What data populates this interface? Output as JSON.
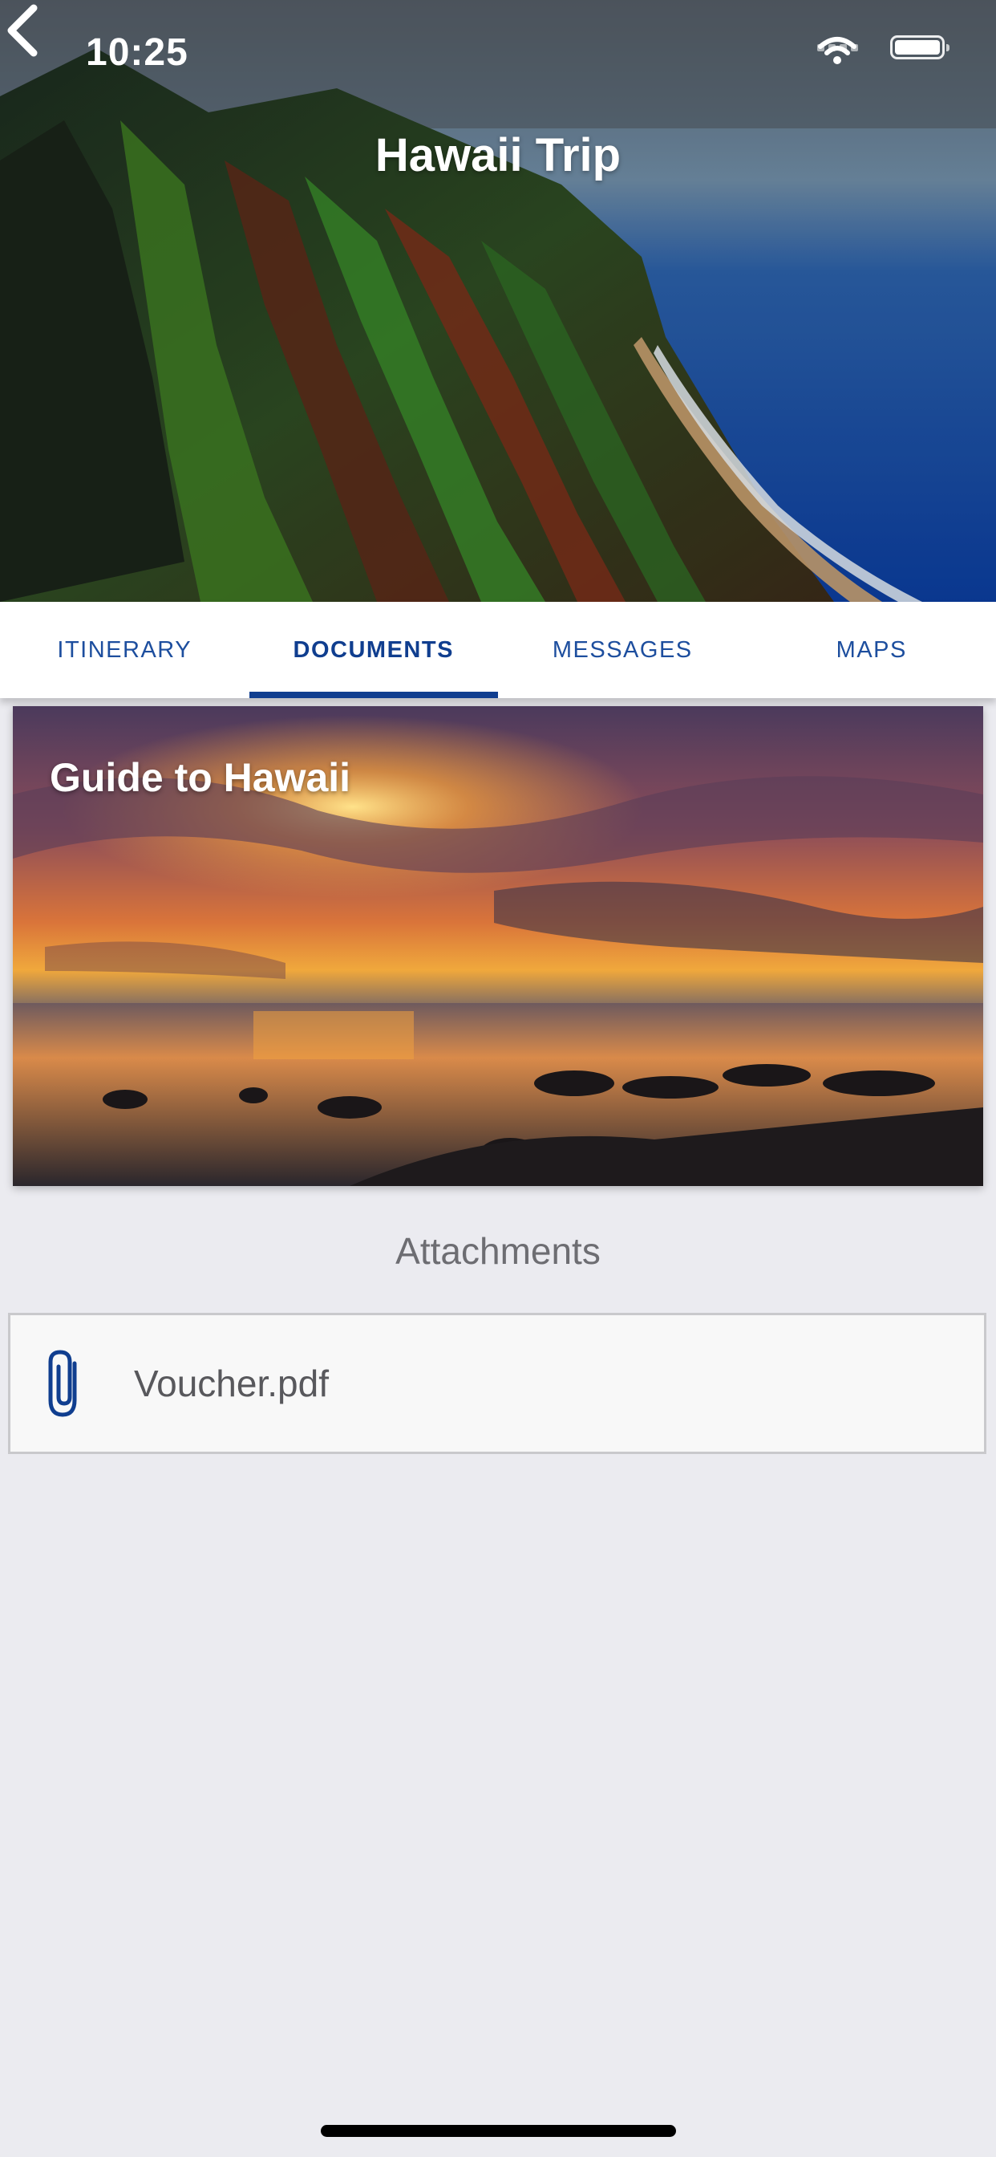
{
  "status_bar": {
    "time": "10:25"
  },
  "nav": {
    "title": "Hawaii Trip"
  },
  "tabs": [
    {
      "label": "ITINERARY",
      "active": false
    },
    {
      "label": "DOCUMENTS",
      "active": true
    },
    {
      "label": "MESSAGES",
      "active": false
    },
    {
      "label": "MAPS",
      "active": false
    }
  ],
  "guide": {
    "title": "Guide to Hawaii"
  },
  "attachments": {
    "heading": "Attachments",
    "items": [
      {
        "name": "Voucher.pdf",
        "icon": "paperclip-icon"
      }
    ]
  },
  "colors": {
    "accent": "#103e8f",
    "tab_text": "#1d4e9e",
    "background": "#ebebf0"
  }
}
